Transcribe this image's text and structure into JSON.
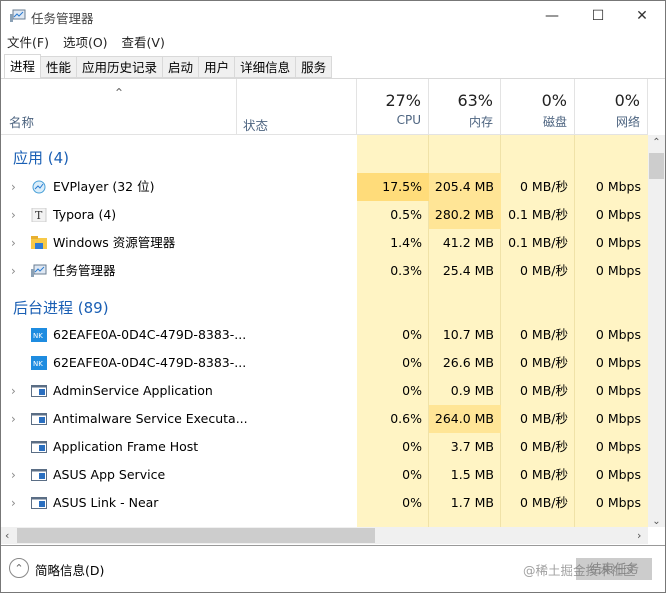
{
  "window": {
    "title": "任务管理器",
    "minimize": "—",
    "maximize": "☐",
    "close": "✕"
  },
  "menu": [
    "文件(F)",
    "选项(O)",
    "查看(V)"
  ],
  "tabs": [
    "进程",
    "性能",
    "应用历史记录",
    "启动",
    "用户",
    "详细信息",
    "服务"
  ],
  "columns": {
    "name": "名称",
    "status": "状态",
    "cpu": {
      "pct": "27%",
      "label": "CPU"
    },
    "mem": {
      "pct": "63%",
      "label": "内存"
    },
    "disk": {
      "pct": "0%",
      "label": "磁盘"
    },
    "net": {
      "pct": "0%",
      "label": "网络"
    }
  },
  "groups": [
    {
      "label": "应用 (4)",
      "rows": [
        {
          "name": "EVPlayer (32 位)",
          "cpu": "17.5%",
          "mem": "205.4 MB",
          "disk": "0 MB/秒",
          "net": "0 Mbps",
          "expand": true,
          "icon": "evplayer-icon"
        },
        {
          "name": "Typora (4)",
          "cpu": "0.5%",
          "mem": "280.2 MB",
          "disk": "0.1 MB/秒",
          "net": "0 Mbps",
          "expand": true,
          "icon": "typora-icon"
        },
        {
          "name": "Windows 资源管理器",
          "cpu": "1.4%",
          "mem": "41.2 MB",
          "disk": "0.1 MB/秒",
          "net": "0 Mbps",
          "expand": true,
          "icon": "folder-icon"
        },
        {
          "name": "任务管理器",
          "cpu": "0.3%",
          "mem": "25.4 MB",
          "disk": "0 MB/秒",
          "net": "0 Mbps",
          "expand": true,
          "icon": "task-manager-icon"
        }
      ]
    },
    {
      "label": "后台进程 (89)",
      "rows": [
        {
          "name": "62EAFE0A-0D4C-479D-8383-...",
          "cpu": "0%",
          "mem": "10.7 MB",
          "disk": "0 MB/秒",
          "net": "0 Mbps",
          "expand": false,
          "icon": "nk-icon"
        },
        {
          "name": "62EAFE0A-0D4C-479D-8383-...",
          "cpu": "0%",
          "mem": "26.6 MB",
          "disk": "0 MB/秒",
          "net": "0 Mbps",
          "expand": false,
          "icon": "nk-icon"
        },
        {
          "name": "AdminService Application",
          "cpu": "0%",
          "mem": "0.9 MB",
          "disk": "0 MB/秒",
          "net": "0 Mbps",
          "expand": true,
          "icon": "app-window-icon"
        },
        {
          "name": "Antimalware Service Executa...",
          "cpu": "0.6%",
          "mem": "264.0 MB",
          "disk": "0 MB/秒",
          "net": "0 Mbps",
          "expand": true,
          "icon": "app-window-icon"
        },
        {
          "name": "Application Frame Host",
          "cpu": "0%",
          "mem": "3.7 MB",
          "disk": "0 MB/秒",
          "net": "0 Mbps",
          "expand": false,
          "icon": "app-window-icon"
        },
        {
          "name": "ASUS App Service",
          "cpu": "0%",
          "mem": "1.5 MB",
          "disk": "0 MB/秒",
          "net": "0 Mbps",
          "expand": true,
          "icon": "app-window-icon"
        },
        {
          "name": "ASUS Link - Near",
          "cpu": "0%",
          "mem": "1.7 MB",
          "disk": "0 MB/秒",
          "net": "0 Mbps",
          "expand": true,
          "icon": "app-window-icon"
        }
      ]
    }
  ],
  "footer": {
    "fewer_details": "简略信息(D)",
    "end_task": "结束任务",
    "watermark": "@稀土掘金技术社区"
  },
  "colors": {
    "heat_bg": "#fff4c4",
    "heat_mid": "#ffe9a3",
    "heat_high": "#ffd970",
    "group": "#1a5fb4"
  }
}
